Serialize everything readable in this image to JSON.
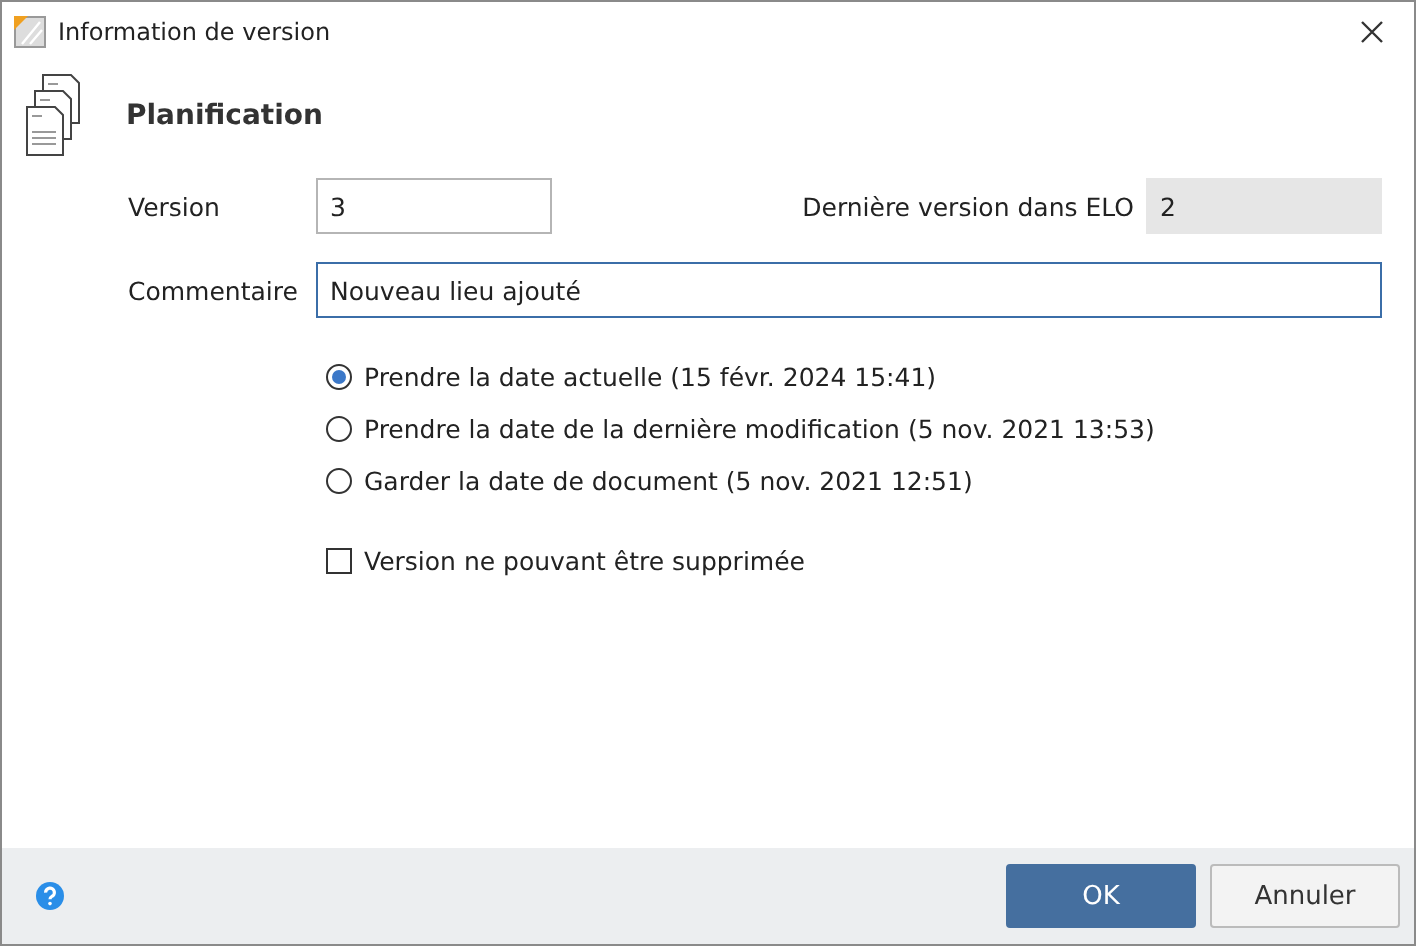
{
  "window": {
    "title": "Information de version"
  },
  "heading": "Planification",
  "version": {
    "label": "Version",
    "value": "3"
  },
  "latest_version": {
    "label": "Dernière version dans ELO",
    "value": "2"
  },
  "comment": {
    "label": "Commentaire",
    "value": "Nouveau lieu ajouté",
    "focused": true
  },
  "date_options": [
    {
      "label": "Prendre la date actuelle (15 févr. 2024 15:41)",
      "selected": true
    },
    {
      "label": "Prendre la date de la dernière modification (5 nov. 2021 13:53)",
      "selected": false
    },
    {
      "label": "Garder la date de document (5 nov. 2021 12:51)",
      "selected": false
    }
  ],
  "undeletable": {
    "label": "Version ne pouvant être supprimée",
    "checked": false
  },
  "buttons": [
    {
      "label": "OK",
      "kind": "primary"
    },
    {
      "label": "Annuler",
      "kind": "secondary"
    }
  ]
}
